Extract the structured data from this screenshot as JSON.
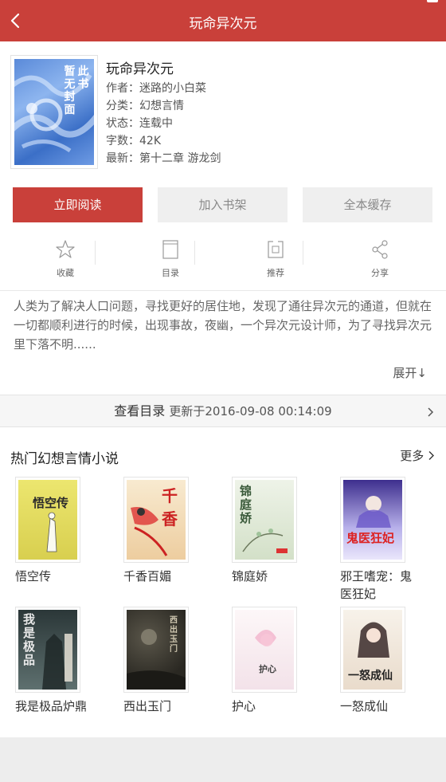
{
  "header": {
    "title": "玩命异次元"
  },
  "book": {
    "name": "玩命异次元",
    "author": "作者：迷路的小白菜",
    "category": "分类：幻想言情",
    "status": "状态：连载中",
    "words": "字数：42K",
    "latest": "最新：第十二章 游龙剑",
    "cover_text_col1": "此书",
    "cover_text_col2": "暂无封面"
  },
  "buttons": {
    "read": "立即阅读",
    "shelf": "加入书架",
    "cache": "全本缓存"
  },
  "actions": [
    {
      "label": "收藏",
      "icon": "star-icon"
    },
    {
      "label": "目录",
      "icon": "catalog-icon"
    },
    {
      "label": "推荐",
      "icon": "recommend-icon"
    },
    {
      "label": "分享",
      "icon": "share-icon"
    }
  ],
  "description": "人类为了解决人口问题，寻找更好的居住地，发现了通往异次元的通道，但就在一切都顺利进行的时候，出现事故，夜幽，一个异次元设计师，为了寻找异次元里下落不明......",
  "expand_label": "展开↓",
  "toc": {
    "label": "查看目录",
    "updated": "更新于2016-09-08 00:14:09"
  },
  "hot": {
    "title": "热门幻想言情小说",
    "more": "更多",
    "books": [
      {
        "title": "悟空传",
        "cover_text": "悟空传",
        "colors": [
          "#e8e06a",
          "#d8cf4f"
        ]
      },
      {
        "title": "千香百媚",
        "cover_text": "千香",
        "colors": [
          "#f5e4c8",
          "#e9c99b"
        ]
      },
      {
        "title": "锦庭娇",
        "cover_text": "锦庭娇",
        "colors": [
          "#e9efe2",
          "#cfdcc4"
        ]
      },
      {
        "title": "邪王嗜宠：鬼医狂妃",
        "cover_text": "鬼医狂妃",
        "colors": [
          "#4a3a9c",
          "#d8d4f2"
        ]
      },
      {
        "title": "我是极品炉鼎",
        "cover_text": "我是极品",
        "colors": [
          "#2f3b3c",
          "#596b6a"
        ]
      },
      {
        "title": "西出玉门",
        "cover_text": "西出玉门",
        "colors": [
          "#2c2a22",
          "#4d4a3c"
        ]
      },
      {
        "title": "护心",
        "cover_text": "护心",
        "colors": [
          "#fbf4f6",
          "#f2dde6"
        ]
      },
      {
        "title": "一怒成仙",
        "cover_text": "一怒成仙",
        "colors": [
          "#f4eee6",
          "#e6d6c7"
        ]
      }
    ]
  },
  "colors": {
    "accent": "#c9403a",
    "button_gray": "#efefef",
    "background": "#ededed"
  }
}
